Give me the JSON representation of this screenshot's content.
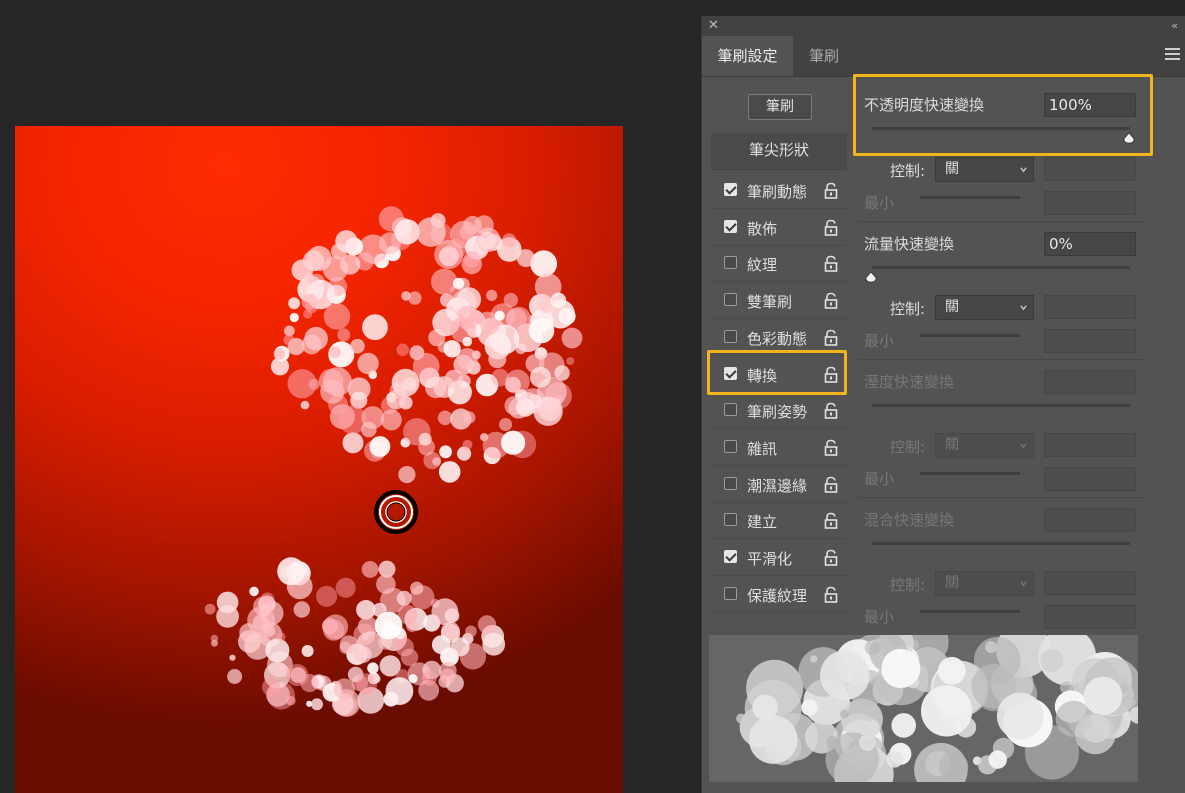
{
  "panel": {
    "close_icon": "close-icon",
    "collapse_icon": "double-chevron-icon",
    "tabs": [
      {
        "label": "筆刷設定",
        "active": true
      },
      {
        "label": "筆刷",
        "active": false
      }
    ],
    "brush_button": "筆刷",
    "tip_shape": "筆尖形狀",
    "options": [
      {
        "label": "筆刷動態",
        "checked": true
      },
      {
        "label": "散佈",
        "checked": true
      },
      {
        "label": "紋理",
        "checked": false
      },
      {
        "label": "雙筆刷",
        "checked": false
      },
      {
        "label": "色彩動態",
        "checked": false
      },
      {
        "label": "轉換",
        "checked": true
      },
      {
        "label": "筆刷姿勢",
        "checked": false
      },
      {
        "label": "雜訊",
        "checked": false
      },
      {
        "label": "潮濕邊緣",
        "checked": false
      },
      {
        "label": "建立",
        "checked": false
      },
      {
        "label": "平滑化",
        "checked": true
      },
      {
        "label": "保護紋理",
        "checked": false
      }
    ],
    "highlight_color": "#f4b51c",
    "sections": {
      "opacity": {
        "label": "不透明度快速變換",
        "value": "100%",
        "level": 1.0
      },
      "opacity_control": {
        "label": "控制:",
        "value": "關"
      },
      "opacity_min": {
        "label": "最小"
      },
      "flow": {
        "label": "流量快速變換",
        "value": "0%",
        "level": 0.0
      },
      "flow_control": {
        "label": "控制:",
        "value": "關"
      },
      "flow_min": {
        "label": "最小"
      },
      "wetness": {
        "label": "溼度快速變換"
      },
      "wetness_control": {
        "label": "控制:",
        "value": "關"
      },
      "wetness_min": {
        "label": "最小"
      },
      "mix": {
        "label": "混合快速變換"
      },
      "mix_control": {
        "label": "控制:",
        "value": "關"
      },
      "mix_min": {
        "label": "最小"
      }
    }
  },
  "canvas": {
    "background": "#e01f00",
    "cursor_icon": "brush-cursor-icon"
  }
}
